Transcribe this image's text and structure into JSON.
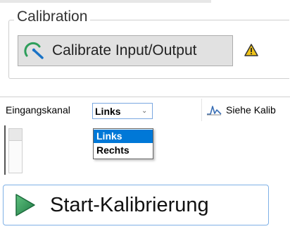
{
  "calibration": {
    "group_title": "Calibration",
    "button_label": "Calibrate Input/Output",
    "button_icon": "calibrate-gauge-icon",
    "warning_icon": "warning-icon",
    "colors": {
      "gauge_arc": "#2e9e5b",
      "gauge_needle": "#1a73c6",
      "warning": "#f0c419"
    }
  },
  "input_channel": {
    "label": "Eingangskanal",
    "selected_value": "Links",
    "options": [
      "Links",
      "Rechts"
    ],
    "highlighted_option": "Links",
    "chevron_icon": "chevron-down-icon",
    "colors": {
      "highlight": "#0078d7"
    }
  },
  "toolbar": {
    "siehe_label": "Siehe Kalib",
    "siehe_icon": "waveform-icon"
  },
  "start": {
    "label": "Start-Kalibrierung",
    "icon": "play-triangle-icon",
    "colors": {
      "play": "#2e8b57"
    }
  }
}
